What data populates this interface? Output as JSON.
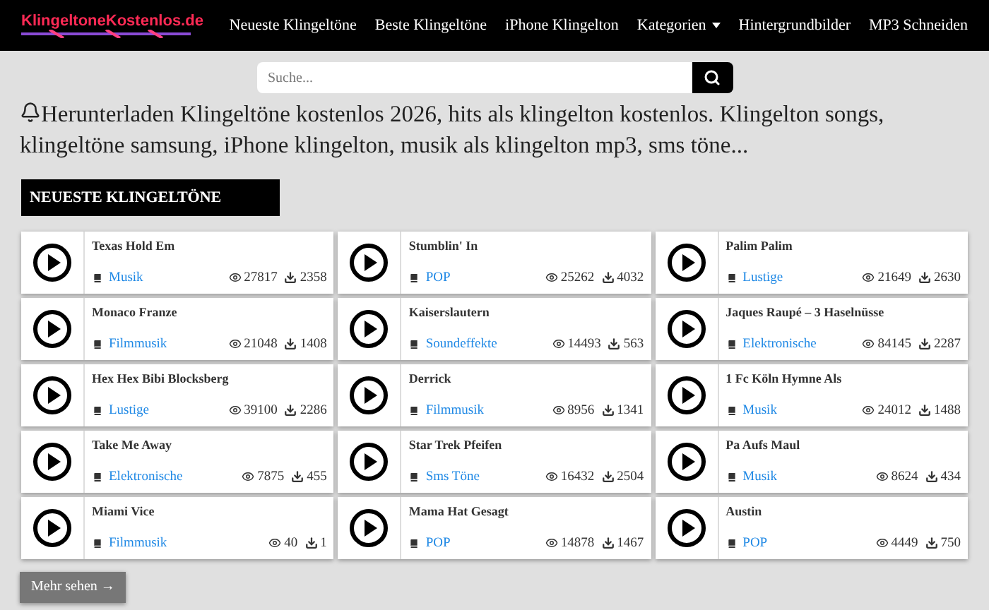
{
  "logo": {
    "text": "KlingeltoneKostenlos.de"
  },
  "nav": [
    {
      "label": "Neueste Klingeltöne",
      "kind": "link"
    },
    {
      "label": "Beste Klingeltöne",
      "kind": "link"
    },
    {
      "label": "iPhone Klingelton",
      "kind": "link"
    },
    {
      "label": "Kategorien",
      "kind": "dropdown"
    },
    {
      "label": "Hintergrundbilder",
      "kind": "link"
    },
    {
      "label": "MP3 Schneiden",
      "kind": "link"
    }
  ],
  "search": {
    "placeholder": "Suche..."
  },
  "intro": "Herunterladen Klingeltöne kostenlos 2026, hits als klingelton kostenlos. Klingelton songs, klingeltöne samsung, iPhone klingelton, musik als klingelton mp3, sms töne...",
  "section_title": "NEUESTE KLINGELTÖNE",
  "ringtones": [
    {
      "title": "Texas Hold Em",
      "category": "Musik",
      "views": "27817",
      "downloads": "2358"
    },
    {
      "title": "Stumblin' In",
      "category": "POP",
      "views": "25262",
      "downloads": "4032"
    },
    {
      "title": "Palim Palim",
      "category": "Lustige",
      "views": "21649",
      "downloads": "2630"
    },
    {
      "title": "Monaco Franze",
      "category": "Filmmusik",
      "views": "21048",
      "downloads": "1408"
    },
    {
      "title": "Kaiserslautern",
      "category": "Soundeffekte",
      "views": "14493",
      "downloads": "563"
    },
    {
      "title": "Jaques Raupé – 3 Haselnüsse",
      "category": "Elektronische",
      "views": "84145",
      "downloads": "2287"
    },
    {
      "title": "Hex Hex Bibi Blocksberg",
      "category": "Lustige",
      "views": "39100",
      "downloads": "2286"
    },
    {
      "title": "Derrick",
      "category": "Filmmusik",
      "views": "8956",
      "downloads": "1341"
    },
    {
      "title": "1 Fc Köln Hymne Als",
      "category": "Musik",
      "views": "24012",
      "downloads": "1488"
    },
    {
      "title": "Take Me Away",
      "category": "Elektronische",
      "views": "7875",
      "downloads": "455"
    },
    {
      "title": "Star Trek Pfeifen",
      "category": "Sms Töne",
      "views": "16432",
      "downloads": "2504"
    },
    {
      "title": "Pa Aufs Maul",
      "category": "Musik",
      "views": "8624",
      "downloads": "434"
    },
    {
      "title": "Miami Vice",
      "category": "Filmmusik",
      "views": "40",
      "downloads": "1"
    },
    {
      "title": "Mama Hat Gesagt",
      "category": "POP",
      "views": "14878",
      "downloads": "1467"
    },
    {
      "title": "Austin",
      "category": "POP",
      "views": "4449",
      "downloads": "750"
    }
  ],
  "more_button": "Mehr sehen →"
}
